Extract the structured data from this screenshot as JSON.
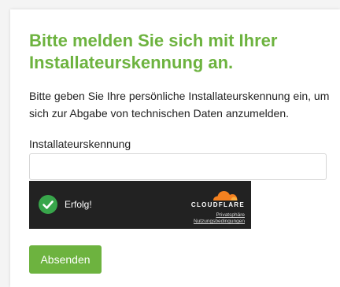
{
  "form": {
    "title": "Bitte melden Sie sich mit Ihrer Installateurskennung an.",
    "description": "Bitte geben Sie Ihre persönliche Installateurskennung ein, um sich zur Abgabe von technischen Daten anzumelden.",
    "field_label": "Installateurskennung",
    "field_value": "",
    "field_placeholder": "",
    "submit_label": "Absenden"
  },
  "captcha": {
    "status_text": "Erfolg!",
    "brand_text": "CLOUDFLARE",
    "privacy_link": "Privatsphäre",
    "terms_link": "Nutzungsbedingungen",
    "success_color": "#38a64b",
    "logo_color": "#f48120",
    "icons": [
      "checkmark-icon",
      "cloudflare-logo-icon"
    ]
  },
  "colors": {
    "accent": "#6db33f",
    "widget_background": "#222222"
  }
}
